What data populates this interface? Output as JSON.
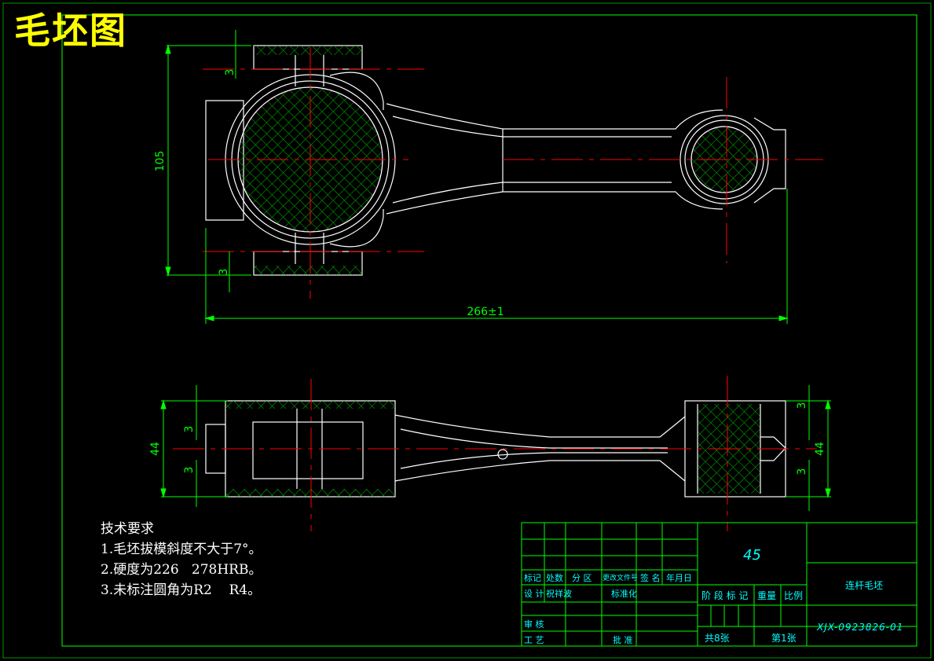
{
  "title": "毛坯图",
  "colors": {
    "frame": "#00ff00",
    "outline": "#ffffff",
    "centerline": "#ff0000",
    "dimension": "#00ff00",
    "hatch": "#00aa00",
    "hatch_edge": "#ff00ff",
    "title": "#ffff00",
    "tb_text": "#00ffff"
  },
  "dimensions": {
    "height_top": "105",
    "allow_top_a": "3",
    "allow_top_b": "3",
    "length_total": "266±1",
    "width_left": "44",
    "width_right": "44",
    "allow_side_a": "3",
    "allow_side_b": "3",
    "allow_side_c": "3",
    "allow_side_d": "3"
  },
  "notes": {
    "heading": "技术要求",
    "items": [
      "1.毛坯拔模斜度不大于7°。",
      "2.硬度为226   278HRB。",
      "3.未标注圆角为R2    R4。"
    ]
  },
  "title_block": {
    "material": "45",
    "part_name": "连杆毛坯",
    "drawing_no": "XJX-0923826-01",
    "hdr_mark": "标记",
    "hdr_count": "处数",
    "hdr_zone": "分 区",
    "hdr_docno": "更改文件号",
    "hdr_sign": "签 名",
    "hdr_date": "年月日",
    "design": "设 计",
    "designer": "祝祥波",
    "standardize": "标准化",
    "stage_label": "阶 段 标 记",
    "weight_label": "重量",
    "scale_label": "比例",
    "review": "审 核",
    "process": "工 艺",
    "approve": "批 准",
    "total_sheets": "共8张",
    "sheet_no": "第1张"
  }
}
